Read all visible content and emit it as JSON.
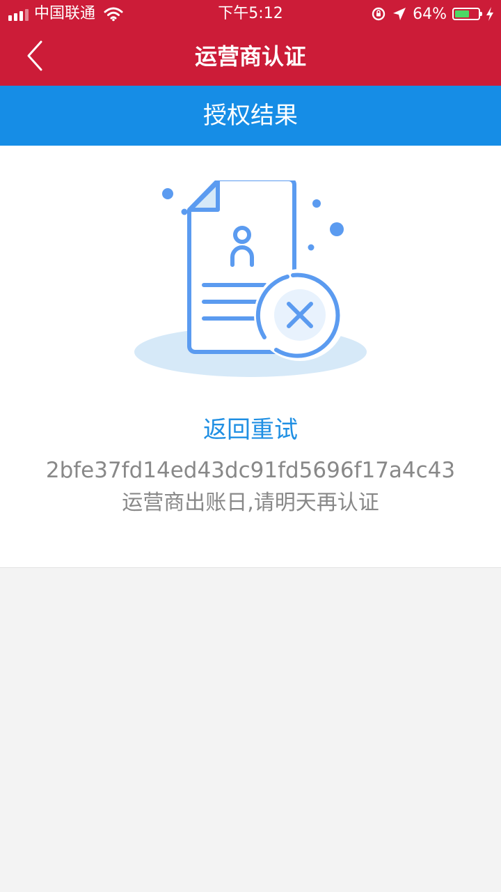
{
  "status_bar": {
    "carrier": "中国联通",
    "time": "下午5:12",
    "battery_percent": "64%",
    "battery_level": 0.64,
    "icons": [
      "signal-icon",
      "wifi-icon",
      "rotation-lock-icon",
      "location-icon",
      "battery-icon",
      "charging-icon"
    ]
  },
  "nav": {
    "title": "运营商认证",
    "back_icon": "chevron-left-icon"
  },
  "section": {
    "title": "授权结果"
  },
  "result": {
    "illustration_icon": "document-error-icon",
    "retry_label": "返回重试",
    "error_code": "2bfe37fd14ed43dc91fd5696f17a4c43",
    "message": "运营商出账日,请明天再认证"
  },
  "colors": {
    "nav_background": "#cc1c38",
    "section_background": "#168de6",
    "accent": "#1f8fe3",
    "illustration_blue": "#5b9bf0",
    "page_background": "#f3f3f3"
  }
}
